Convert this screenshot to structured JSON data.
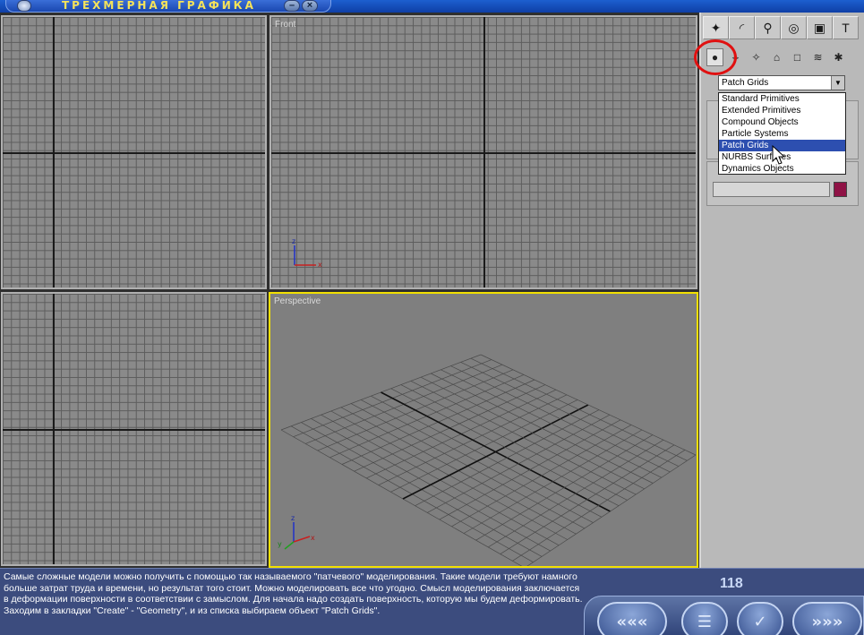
{
  "window": {
    "title": "ТРЕХМЕРНАЯ ГРАФИКА",
    "minimize_label": "–",
    "close_label": "×"
  },
  "viewports": {
    "front_label": "Front",
    "perspective_label": "Perspective",
    "axis_z": "z",
    "axis_x": "x",
    "axis_y": "y"
  },
  "command_panel": {
    "tabs": [
      "create-icon",
      "modify-icon",
      "hierarchy-icon",
      "motion-icon",
      "display-icon",
      "utilities-icon"
    ],
    "tab_glyphs": [
      "✦",
      "◜",
      "⚲",
      "◎",
      "▣",
      "T"
    ],
    "subcategories": [
      "geometry-icon",
      "shapes-icon",
      "lights-icon",
      "cameras-icon",
      "helpers-icon",
      "space-warps-icon",
      "systems-icon"
    ],
    "subcategory_glyphs": [
      "●",
      "⟡",
      "✧",
      "⌂",
      "□",
      "≋",
      "✱"
    ],
    "category_selected": "Patch Grids",
    "category_arrow": "▼",
    "dropdown_items": [
      "Standard Primitives",
      "Extended Primitives",
      "Compound Objects",
      "Particle Systems",
      "Patch Grids",
      "NURBS Surfaces",
      "Dynamics Objects"
    ],
    "dropdown_selected_index": 4,
    "color_swatch": "#8f1245"
  },
  "lesson": {
    "text": "Самые сложные модели можно получить с помощью так называемого \"патчевого\" моделирования. Такие модели требуют намного больше затрат труда и времени, но результат того стоит. Можно моделировать все что угодно. Смысл моделирования заключается в деформации поверхности в соответствии с замыслом. Для начала надо создать поверхность, которую мы будем деформировать. Заходим в закладки \"Create\" - \"Geometry\", и из списка выбираем объект \"Patch Grids\".",
    "page_number": "118"
  },
  "navigation": {
    "first_label": "«««",
    "contents_label": "☰",
    "check_label": "✓",
    "next_label": "»»»"
  }
}
